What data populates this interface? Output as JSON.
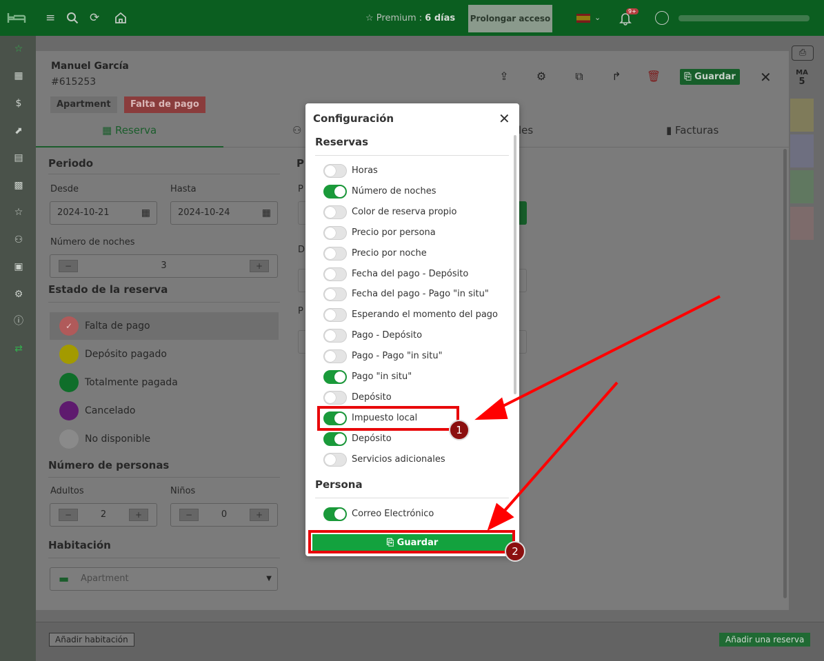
{
  "topbar": {
    "premium_label": "Premium : ",
    "premium_days": "6 días",
    "prolong_label": "Prolongar acceso",
    "notifications_badge": "9+"
  },
  "calendar": {
    "ma_label": "MA",
    "ma_day": "5",
    "add_room_label": "Añadir habitación",
    "add_booking_label": "Añadir una reserva"
  },
  "booking": {
    "guest_name": "Manuel García",
    "booking_id": "#615253",
    "tag_type": "Apartment",
    "tag_status": "Falta de pago",
    "save_label": "Guardar",
    "tabs": {
      "reserva": "Reserva",
      "facturas": "Facturas",
      "partial": "les"
    },
    "period": {
      "title": "Periodo",
      "from_label": "Desde",
      "to_label": "Hasta",
      "from_value": "2024-10-21",
      "to_value": "2024-10-24",
      "nights_label": "Número de noches",
      "nights_value": "3"
    },
    "status": {
      "title": "Estado de la reserva",
      "items": [
        {
          "label": "Falta de pago",
          "color": "#b05a5a"
        },
        {
          "label": "Depósito pagado",
          "color": "#a39a00"
        },
        {
          "label": "Totalmente pagada",
          "color": "#0f6e2a"
        },
        {
          "label": "Cancelado",
          "color": "#5e1a6e"
        },
        {
          "label": "No disponible",
          "color": "#8a8a8a"
        }
      ]
    },
    "persons": {
      "title": "Número de personas",
      "adults_label": "Adultos",
      "adults_value": "2",
      "children_label": "Niños",
      "children_value": "0"
    },
    "room": {
      "title": "Habitación",
      "placeholder": "Apartment"
    },
    "col2": {
      "p1": "P",
      "p2": "P",
      "d": "D",
      "p3": "P"
    }
  },
  "config": {
    "title": "Configuración",
    "section_reservas": "Reservas",
    "section_persona": "Persona",
    "save_label": "Guardar",
    "reservas_items": [
      {
        "label": "Horas",
        "on": false
      },
      {
        "label": "Número de noches",
        "on": true
      },
      {
        "label": "Color de reserva propio",
        "on": false
      },
      {
        "label": "Precio por persona",
        "on": false
      },
      {
        "label": "Precio por noche",
        "on": false
      },
      {
        "label": "Fecha del pago - Depósito",
        "on": false
      },
      {
        "label": "Fecha del pago - Pago \"in situ\"",
        "on": false
      },
      {
        "label": "Esperando el momento del pago",
        "on": false
      },
      {
        "label": "Pago - Depósito",
        "on": false
      },
      {
        "label": "Pago - Pago \"in situ\"",
        "on": false
      },
      {
        "label": "Pago \"in situ\"",
        "on": true
      },
      {
        "label": "Depósito",
        "on": false
      },
      {
        "label": "Impuesto local",
        "on": true
      },
      {
        "label": "Depósito",
        "on": true
      },
      {
        "label": "Servicios adicionales",
        "on": false
      }
    ],
    "persona_items": [
      {
        "label": "Correo Electrónico",
        "on": true
      }
    ]
  },
  "annotations": {
    "badge1": "1",
    "badge2": "2"
  }
}
